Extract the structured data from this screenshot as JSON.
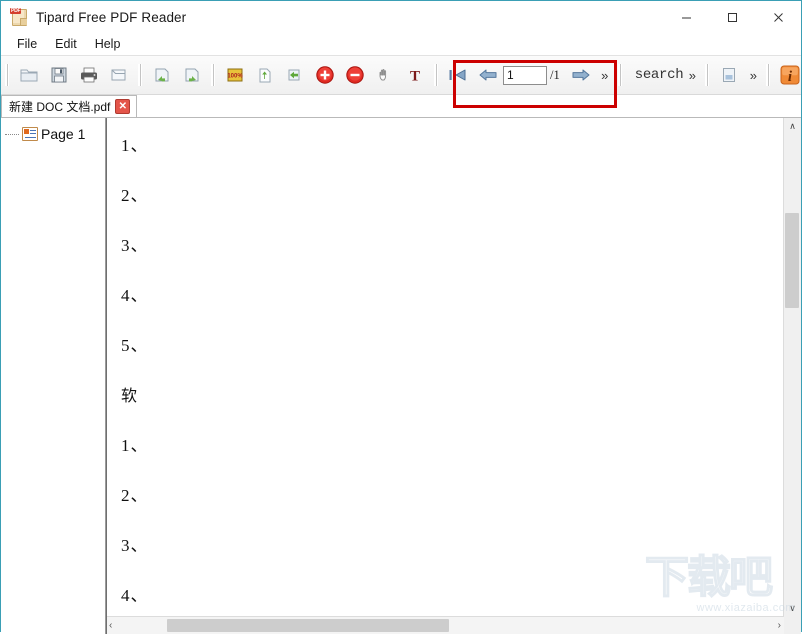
{
  "window": {
    "title": "Tipard Free PDF Reader",
    "app_icon": "pdf-document-icon",
    "controls": {
      "minimize": "minimize-icon",
      "maximize": "maximize-icon",
      "close": "close-icon"
    },
    "accent_border": "#3a9fb5"
  },
  "menubar": {
    "items": [
      {
        "label": "File"
      },
      {
        "label": "Edit"
      },
      {
        "label": "Help"
      }
    ]
  },
  "toolbar": {
    "groups": [
      {
        "name": "file-group",
        "buttons": [
          {
            "name": "open-icon",
            "title": "Open",
            "disabled": false
          },
          {
            "name": "save-icon",
            "title": "Save",
            "disabled": false
          },
          {
            "name": "print-icon",
            "title": "Print",
            "disabled": false
          },
          {
            "name": "export-page-icon",
            "title": "Export",
            "disabled": false
          }
        ]
      },
      {
        "name": "rotate-group",
        "buttons": [
          {
            "name": "rotate-left-icon",
            "title": "Rotate Left"
          },
          {
            "name": "rotate-right-icon",
            "title": "Rotate Right"
          }
        ]
      },
      {
        "name": "zoom-group",
        "buttons": [
          {
            "name": "actual-size-icon",
            "title": "100%"
          },
          {
            "name": "fit-page-icon",
            "title": "Fit Page"
          },
          {
            "name": "fit-width-icon",
            "title": "Fit Width"
          },
          {
            "name": "zoom-in-icon",
            "title": "Zoom In"
          },
          {
            "name": "zoom-out-icon",
            "title": "Zoom Out"
          },
          {
            "name": "hand-tool-icon",
            "title": "Hand Tool"
          },
          {
            "name": "text-select-icon",
            "title": "Select Text"
          }
        ]
      }
    ],
    "navigation": {
      "first_page_icon": "first-page-icon",
      "previous_page_icon": "previous-page-icon",
      "next_page_icon": "next-page-icon",
      "overflow_label": "»",
      "page_value": "1",
      "page_total": "/1",
      "highlight_color": "#cc0000"
    },
    "search": {
      "label": "search",
      "overflow_label": "»"
    },
    "view_group": {
      "layout_icon": "page-layout-icon",
      "overflow_label": "»"
    },
    "info_button": {
      "name": "info-icon",
      "glyph": "i",
      "color": "#ef7f2e",
      "dropdown": "▼"
    }
  },
  "tabstrip": {
    "tabs": [
      {
        "label": "新建 DOC 文档.pdf",
        "close": "✕",
        "active": true
      }
    ]
  },
  "sidebar": {
    "items": [
      {
        "label": "Page 1",
        "icon": "page-thumbnail-icon"
      }
    ]
  },
  "document": {
    "lines": [
      {
        "text": "1、",
        "cjk": false
      },
      {
        "text": "2、",
        "cjk": false
      },
      {
        "text": "3、",
        "cjk": false
      },
      {
        "text": "4、",
        "cjk": false
      },
      {
        "text": "5、",
        "cjk": false
      },
      {
        "text": "软",
        "cjk": true
      },
      {
        "text": "1、",
        "cjk": false
      },
      {
        "text": "2、",
        "cjk": false
      },
      {
        "text": "3、",
        "cjk": false
      },
      {
        "text": "4、",
        "cjk": false
      }
    ]
  },
  "scrollbars": {
    "vertical": {
      "up": "∧",
      "down": "∨"
    },
    "horizontal": {
      "left": "‹",
      "right": "›"
    }
  },
  "watermark": {
    "text": "下载吧",
    "url": "www.xiazaiba.com"
  }
}
